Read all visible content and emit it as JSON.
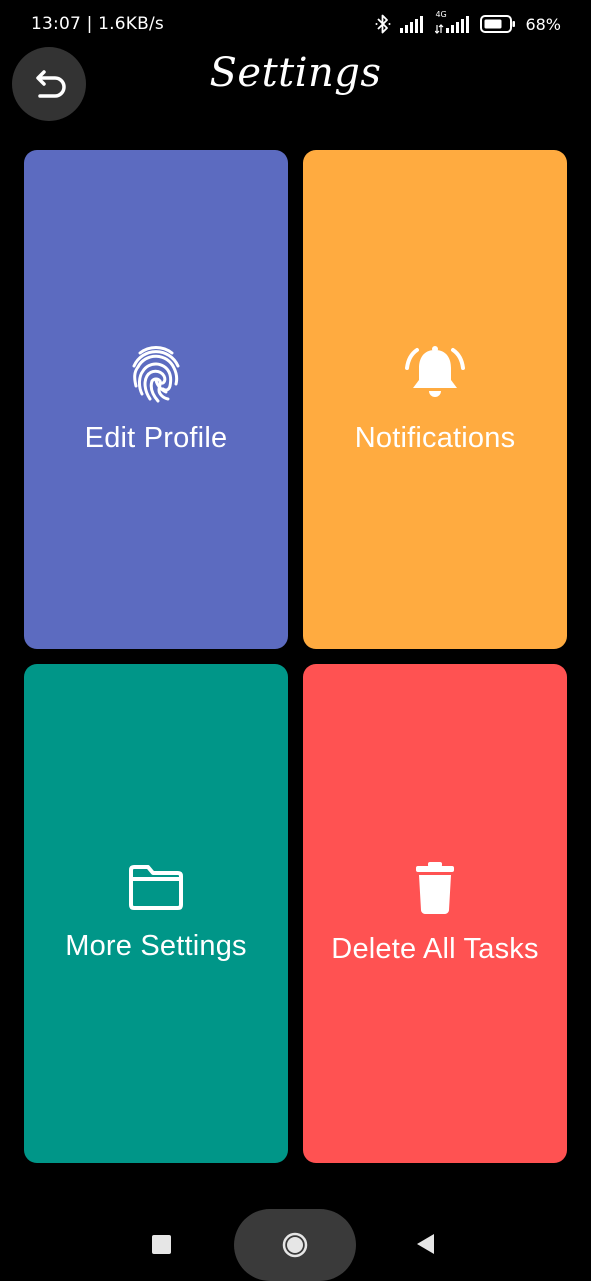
{
  "status_bar": {
    "time_speed": "13:07 | 1.6KB/s",
    "network_label": "4G",
    "battery_percent": "68%"
  },
  "header": {
    "title": "Settings",
    "back_icon": "undo-arrow-icon"
  },
  "tiles": [
    {
      "label": "Edit Profile",
      "icon": "fingerprint-icon",
      "color": "#5c6bc0"
    },
    {
      "label": "Notifications",
      "icon": "bell-ringing-icon",
      "color": "#ffab40"
    },
    {
      "label": "More Settings",
      "icon": "folder-icon",
      "color": "#009688"
    },
    {
      "label": "Delete All Tasks",
      "icon": "trash-icon",
      "color": "#ff5252"
    }
  ],
  "nav_bar": {
    "recents_icon": "square-icon",
    "home_icon": "circle-icon",
    "back_icon": "triangle-back-icon"
  }
}
